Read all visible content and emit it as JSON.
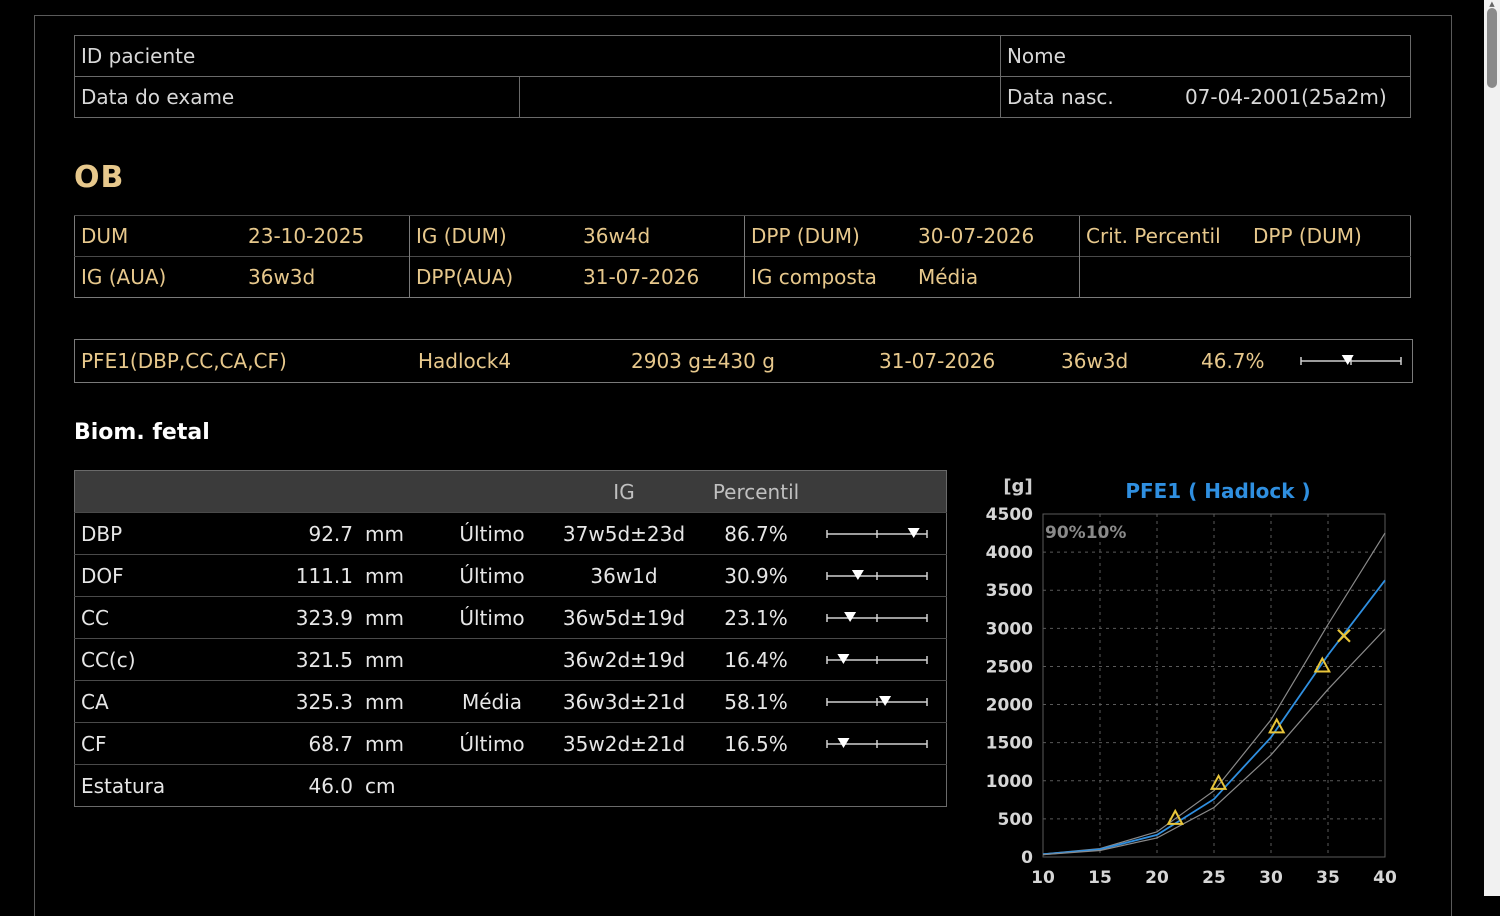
{
  "header": {
    "patient_id_label": "ID paciente",
    "name_label": "Nome",
    "exam_date_label": "Data do exame",
    "birth_label": "Data nasc.",
    "birth_value": "07-04-2001(25a2m)"
  },
  "section_title": "OB",
  "ob": {
    "dum_label": "DUM",
    "dum_value": "23-10-2025",
    "ig_dum_label": "IG (DUM)",
    "ig_dum_value": "36w4d",
    "dpp_dum_label": "DPP (DUM)",
    "dpp_dum_value": "30-07-2026",
    "crit_label": "Crit. Percentil",
    "crit_value": "DPP (DUM)",
    "ig_aua_label": "IG (AUA)",
    "ig_aua_value": "36w3d",
    "dpp_aua_label": "DPP(AUA)",
    "dpp_aua_value": "31-07-2026",
    "ig_comp_label": "IG composta",
    "ig_comp_value": "Média"
  },
  "pfe": {
    "label": "PFE1(DBP,CC,CA,CF)",
    "method": "Hadlock4",
    "weight": "2903 g±430 g",
    "date": "31-07-2026",
    "ga": "36w3d",
    "percentile": "46.7%",
    "percentile_value": 0.467
  },
  "biom": {
    "title": "Biom. fetal",
    "headers": {
      "ig": "IG",
      "percentil": "Percentil"
    },
    "rows": [
      {
        "name": "DBP",
        "value": "92.7",
        "unit": "mm",
        "method": "Último",
        "ig": "37w5d±23d",
        "percentil": "86.7%",
        "p": 0.867
      },
      {
        "name": "DOF",
        "value": "111.1",
        "unit": "mm",
        "method": "Último",
        "ig": "36w1d",
        "percentil": "30.9%",
        "p": 0.309
      },
      {
        "name": "CC",
        "value": "323.9",
        "unit": "mm",
        "method": "Último",
        "ig": "36w5d±19d",
        "percentil": "23.1%",
        "p": 0.231
      },
      {
        "name": "CC(c)",
        "value": "321.5",
        "unit": "mm",
        "method": "",
        "ig": "36w2d±19d",
        "percentil": "16.4%",
        "p": 0.164
      },
      {
        "name": "CA",
        "value": "325.3",
        "unit": "mm",
        "method": "Média",
        "ig": "36w3d±21d",
        "percentil": "58.1%",
        "p": 0.581
      },
      {
        "name": "CF",
        "value": "68.7",
        "unit": "mm",
        "method": "Último",
        "ig": "35w2d±21d",
        "percentil": "16.5%",
        "p": 0.165
      },
      {
        "name": "Estatura",
        "value": "46.0",
        "unit": "cm",
        "method": "",
        "ig": "",
        "percentil": "",
        "p": null
      }
    ]
  },
  "chart_data": {
    "type": "line",
    "title": "PFE1 ( Hadlock )",
    "ylabel": "[g]",
    "legend": "90%10%",
    "xlim": [
      10,
      40
    ],
    "ylim": [
      0,
      4500
    ],
    "xticks": [
      10,
      15,
      20,
      25,
      30,
      35,
      40
    ],
    "yticks": [
      0,
      500,
      1000,
      1500,
      2000,
      2500,
      3000,
      3500,
      4000,
      4500
    ],
    "grid": true,
    "title_color": "#2f8fe0",
    "x": [
      10,
      15,
      20,
      25,
      30,
      35,
      40
    ],
    "series": [
      {
        "values": [
          40,
          110,
          330,
          870,
          1800,
          3050,
          4250
        ],
        "color": "#8a8a8a"
      },
      {
        "values": [
          35,
          100,
          290,
          760,
          1570,
          2650,
          3630
        ],
        "color": "#2f8fe0"
      },
      {
        "values": [
          30,
          85,
          250,
          650,
          1340,
          2200,
          2990
        ],
        "color": "#8a8a8a"
      }
    ],
    "points": [
      {
        "x": 21.6,
        "y": 500,
        "marker": "triangle"
      },
      {
        "x": 25.4,
        "y": 960,
        "marker": "triangle"
      },
      {
        "x": 30.5,
        "y": 1700,
        "marker": "triangle"
      },
      {
        "x": 34.5,
        "y": 2500,
        "marker": "triangle"
      },
      {
        "x": 36.4,
        "y": 2903,
        "marker": "cross"
      }
    ],
    "marker_color": "#e8c53a"
  }
}
